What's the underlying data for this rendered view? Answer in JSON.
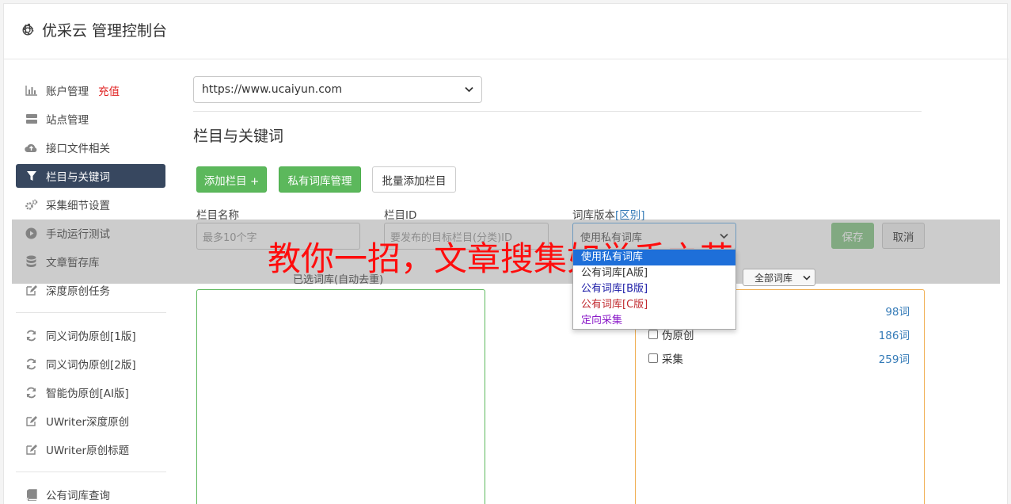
{
  "app": {
    "title": "优采云 管理控制台"
  },
  "sidebar": {
    "items": [
      {
        "label": "账户管理",
        "extra": "充值",
        "icon": "bar-chart-icon"
      },
      {
        "label": "站点管理",
        "icon": "server-icon"
      },
      {
        "label": "接口文件相关",
        "icon": "cloud-upload-icon"
      },
      {
        "label": "栏目与关键词",
        "icon": "filter-icon",
        "active": true
      },
      {
        "label": "采集细节设置",
        "icon": "gears-icon"
      },
      {
        "label": "手动运行测试",
        "icon": "play-circle-icon"
      },
      {
        "label": "文章暂存库",
        "icon": "database-icon"
      },
      {
        "label": "深度原创任务",
        "icon": "edit-icon"
      },
      {
        "label": "同义词伪原创[1版]",
        "icon": "refresh-icon"
      },
      {
        "label": "同义词伪原创[2版]",
        "icon": "refresh-icon"
      },
      {
        "label": "智能伪原创[AI版]",
        "icon": "refresh-icon"
      },
      {
        "label": "UWriter深度原创",
        "icon": "edit-icon"
      },
      {
        "label": "UWriter原创标题",
        "icon": "edit-icon"
      },
      {
        "label": "公有词库查询",
        "icon": "book-icon"
      }
    ]
  },
  "site_select": {
    "value": "https://www.ucaiyun.com"
  },
  "section": {
    "title": "栏目与关键词"
  },
  "buttons": {
    "add_column": "添加栏目 +",
    "private_lib": "私有词库管理",
    "batch_add": "批量添加栏目",
    "save": "保存",
    "cancel": "取消"
  },
  "form": {
    "name_label": "栏目名称",
    "name_placeholder": "最多10个字",
    "id_label": "栏目ID",
    "id_placeholder": "要发布的目标栏目(分类)ID",
    "lib_label": "词库版本",
    "lib_link": "[区别]",
    "lib_value": "使用私有词库"
  },
  "dropdown": {
    "options": [
      {
        "label": "使用私有词库",
        "color": "#ffffff",
        "selected": true
      },
      {
        "label": "公有词库[A版]",
        "color": "#333333"
      },
      {
        "label": "公有词库[B版]",
        "color": "#1a1aa6"
      },
      {
        "label": "公有词库[C版]",
        "color": "#c0282d"
      },
      {
        "label": "定向采集",
        "color": "#8a1ac8"
      }
    ]
  },
  "selected_libs": {
    "label": "已选词库(自动去重)"
  },
  "filter": {
    "value": "全部词库"
  },
  "libs": [
    {
      "name": "",
      "count": "98词"
    },
    {
      "name": "伪原创",
      "count": "186词"
    },
    {
      "name": "采集",
      "count": "259词"
    }
  ],
  "banner": {
    "text": "教你一招，文章搜集如举手之劳"
  }
}
